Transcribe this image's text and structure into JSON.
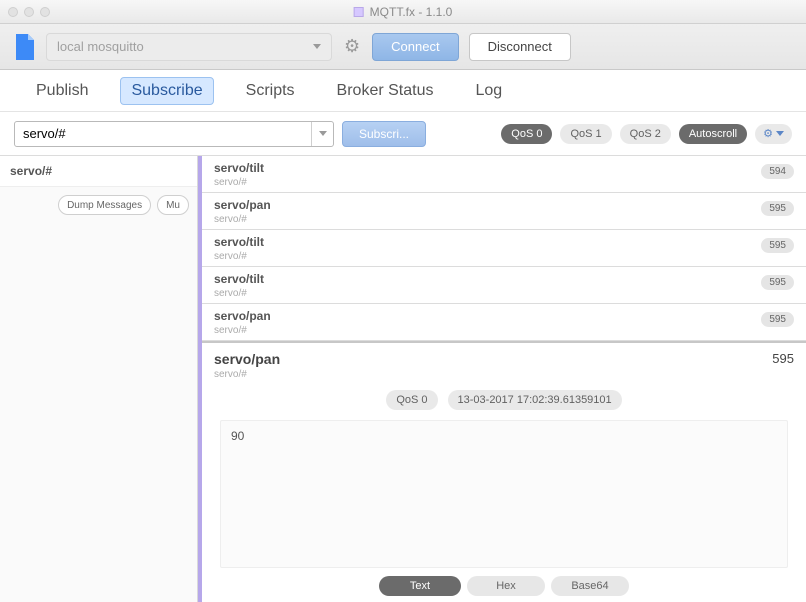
{
  "window": {
    "title": "MQTT.fx - 1.1.0"
  },
  "toolbar": {
    "connection_placeholder": "local mosquitto",
    "connect_label": "Connect",
    "disconnect_label": "Disconnect"
  },
  "tabs": {
    "publish": "Publish",
    "subscribe": "Subscribe",
    "scripts": "Scripts",
    "broker_status": "Broker Status",
    "log": "Log"
  },
  "subscribe": {
    "topic_value": "servo/#",
    "subscribe_label": "Subscri...",
    "qos0": "QoS 0",
    "qos1": "QoS 1",
    "qos2": "QoS 2",
    "autoscroll": "Autoscroll"
  },
  "left": {
    "subscription": "servo/#",
    "dump_label": "Dump Messages",
    "mute_label": "Mu"
  },
  "messages": [
    {
      "topic": "servo/tilt",
      "source": "servo/#",
      "count": "594"
    },
    {
      "topic": "servo/pan",
      "source": "servo/#",
      "count": "595"
    },
    {
      "topic": "servo/tilt",
      "source": "servo/#",
      "count": "595"
    },
    {
      "topic": "servo/tilt",
      "source": "servo/#",
      "count": "595"
    },
    {
      "topic": "servo/pan",
      "source": "servo/#",
      "count": "595"
    }
  ],
  "detail": {
    "topic": "servo/pan",
    "source": "servo/#",
    "count": "595",
    "qos": "QoS 0",
    "timestamp": "13-03-2017  17:02:39.61359101",
    "payload": "90",
    "fmt_text": "Text",
    "fmt_hex": "Hex",
    "fmt_b64": "Base64"
  }
}
